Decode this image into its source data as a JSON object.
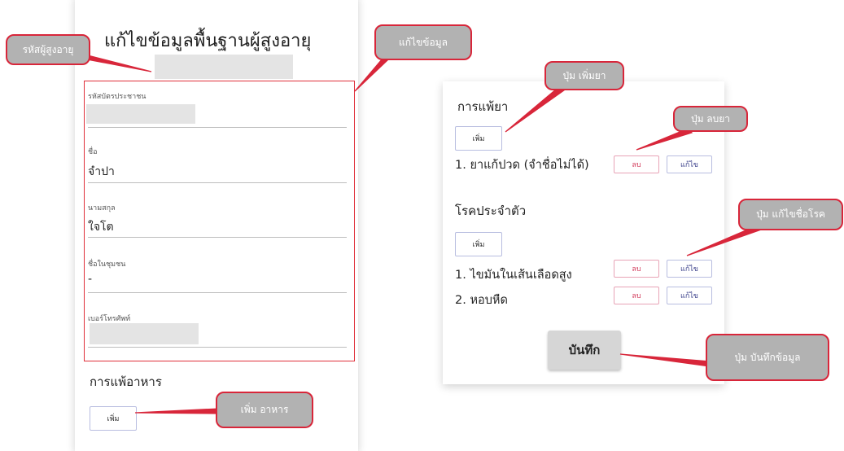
{
  "left_form": {
    "title": "แก้ไขข้อมูลพื้นฐานผู้สูงอายุ",
    "fields": [
      {
        "label": "รหัสบัตรประชาชน",
        "value": ""
      },
      {
        "label": "ชื่อ",
        "value": "จำปา"
      },
      {
        "label": "นามสกุล",
        "value": "ใจโต"
      },
      {
        "label": "ชื่อในชุมชน",
        "value": "-"
      },
      {
        "label": "เบอร์โทรศัพท์",
        "value": ""
      }
    ],
    "food_allergy": {
      "title": "การแพ้อาหาร",
      "add_label": "เพิ่ม"
    }
  },
  "right_form": {
    "drug_allergy": {
      "title": "การแพ้ยา",
      "add_label": "เพิ่ม",
      "items": [
        {
          "text": "1. ยาแก้ปวด (จำชื่อไม่ได้)",
          "delete_label": "ลบ",
          "edit_label": "แก้ไข"
        }
      ]
    },
    "chronic_disease": {
      "title": "โรคประจำตัว",
      "add_label": "เพิ่ม",
      "items": [
        {
          "text": "1. ไขมันในเส้นเลือดสูง",
          "delete_label": "ลบ",
          "edit_label": "แก้ไข"
        },
        {
          "text": "2. หอบหืด",
          "delete_label": "ลบ",
          "edit_label": "แก้ไข"
        }
      ]
    },
    "save_label": "บันทึก"
  },
  "callouts": {
    "elder_id": "รหัสผู้สูงอายุ",
    "edit_info": "แก้ไขข้อมูล",
    "add_drug": "ปุ่ม เพิ่มยา",
    "delete_drug": "ปุ่ม ลบยา",
    "edit_disease": "ปุ่ม แก้ไขชื่อโรค",
    "save_data": "ปุ่ม บันทึกข้อมูล",
    "add_food": "เพิ่ม อาหาร"
  },
  "colors": {
    "callout_fill": "#b2b2b2",
    "callout_border": "#d8263a",
    "annotation_line": "#d8263a"
  }
}
